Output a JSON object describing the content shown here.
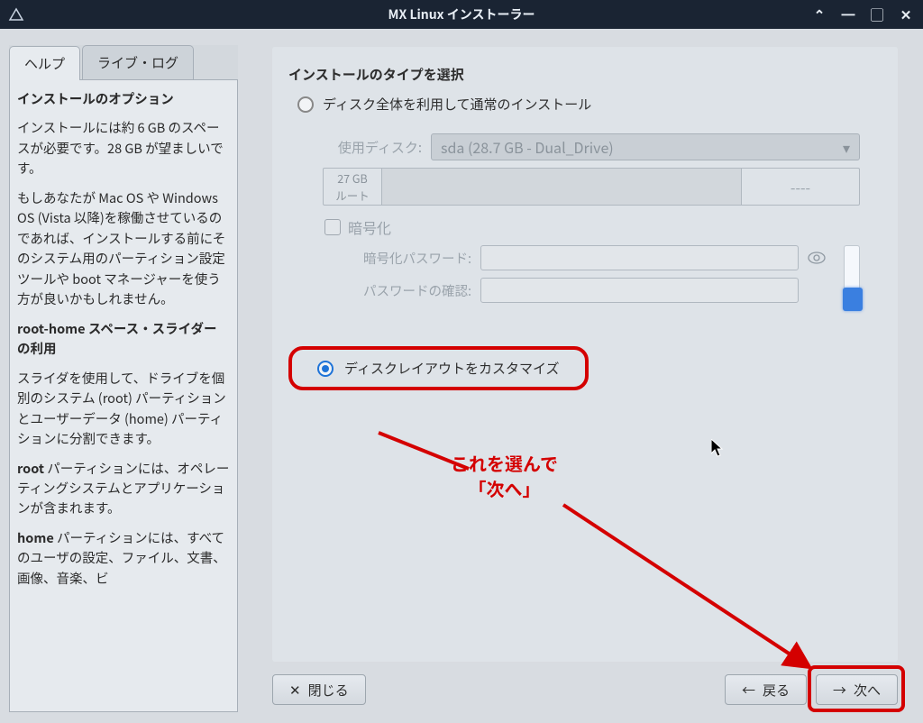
{
  "titlebar": {
    "title": "MX Linux インストーラー"
  },
  "tabs": {
    "help": "ヘルプ",
    "livelog": "ライブ・ログ"
  },
  "help": {
    "h1": "インストールのオプション",
    "p1": "インストールには約 6 GB のスペースが必要です。28 GB が望ましいです。",
    "p2": "もしあなたが Mac OS や Windows OS (Vista 以降)を稼働させているのであれば、インストールする前にそのシステム用のパーティション設定ツールや boot マネージャーを使う方が良いかもしれません。",
    "h2": "root-home スペース・スライダーの利用",
    "p3": "スライダを使用して、ドライブを個別のシステム (root) パーティションとユーザーデータ (home) パーティションに分割できます。",
    "p4a": "root",
    "p4b": " パーティションには、オペレーティングシステムとアプリケーションが含まれます。",
    "p5a": "home",
    "p5b": " パーティションには、すべてのユーザの設定、ファイル、文書、画像、音楽、ビ"
  },
  "main": {
    "section_title": "インストールのタイプを選択",
    "radio_full": "ディスク全体を利用して通常のインストール",
    "use_disk_label": "使用ディスク:",
    "disk_value": "sda (28.7 GB - Dual_Drive)",
    "part_size": "27 GB",
    "part_mount": "ルート",
    "part_right": "----",
    "encrypt_label": "暗号化",
    "pw_label": "暗号化パスワード:",
    "pw_confirm_label": "パスワードの確認:",
    "radio_custom": "ディスクレイアウトをカスタマイズ"
  },
  "annotation": {
    "line1": "これを選んで",
    "line2": "「次へ」"
  },
  "buttons": {
    "close": "閉じる",
    "back": "戻る",
    "next": "次へ"
  }
}
